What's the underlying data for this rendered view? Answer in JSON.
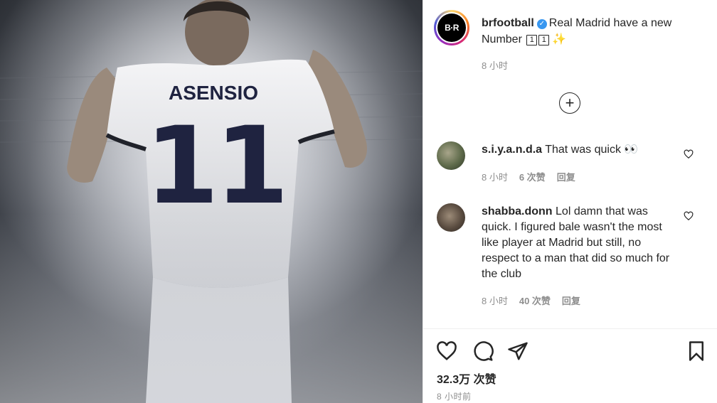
{
  "post": {
    "jersey_name": "ASENSIO",
    "jersey_number": "11"
  },
  "author": {
    "username": "brfootball",
    "avatar_text": "B·R",
    "verified_icon": "verified-badge-icon"
  },
  "caption": {
    "text": "Real Madrid have a new Number",
    "keycap_1": "1",
    "keycap_2": "1",
    "emoji": "✨",
    "time": "8 小时"
  },
  "load_more": {
    "icon": "plus-circle-icon",
    "symbol": "+"
  },
  "comments": [
    {
      "username": "s.i.y.a.n.d.a",
      "text": "That was quick 👀",
      "time": "8 小时",
      "likes": "6 次赞",
      "reply": "回复"
    },
    {
      "username": "shabba.donn",
      "text": "Lol damn that was quick. I figured bale wasn't the most like player at Madrid but still, no respect to a man that did so much for the club",
      "time": "8 小时",
      "likes": "40 次赞",
      "reply": "回复"
    }
  ],
  "actions": {
    "like_icon": "heart-icon",
    "comment_icon": "comment-icon",
    "share_icon": "paper-plane-icon",
    "save_icon": "bookmark-icon"
  },
  "stats": {
    "likes": "32.3万 次赞",
    "posted": "8 小时前"
  },
  "colors": {
    "text": "#262626",
    "muted": "#8e8e8e",
    "verified": "#3897f0",
    "jersey_number": "#1f2340"
  }
}
